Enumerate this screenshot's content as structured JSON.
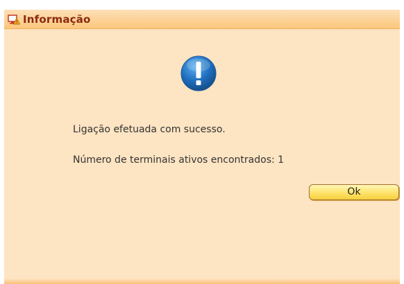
{
  "dialog": {
    "title": "Informação",
    "title_icon": "warning-display-icon",
    "icon": "exclamation-info-icon",
    "messages": {
      "line1": "Ligação efetuada com sucesso.",
      "line2": "Número de terminais ativos encontrados: 1"
    },
    "ok_label": "Ok"
  },
  "colors": {
    "background": "#fde4c2",
    "titlebar": "#fbc77c",
    "title_text": "#8b2a12",
    "icon_blue": "#1f6fbf",
    "button": "#fee36a"
  }
}
